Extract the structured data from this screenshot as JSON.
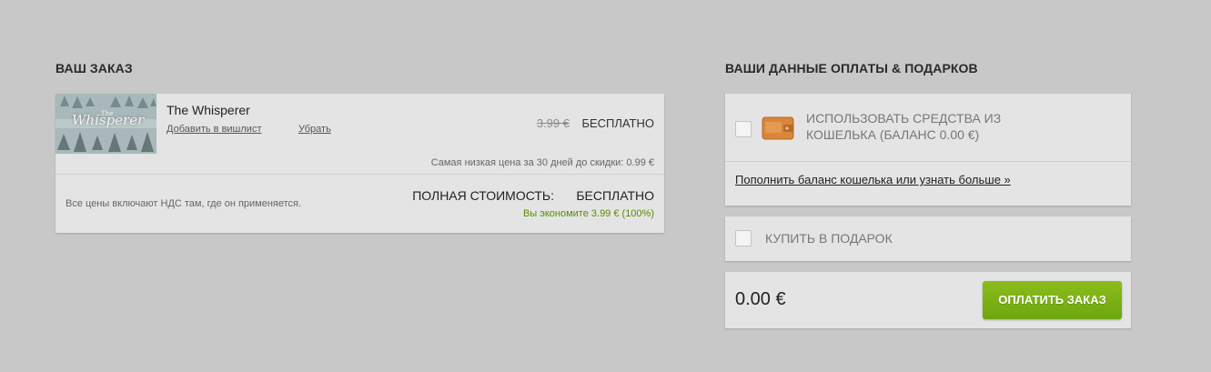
{
  "order": {
    "title": "ВАШ ЗАКАЗ",
    "item": {
      "name": "The Whisperer",
      "thumb_title_small": "The",
      "thumb_title": "Whisperer",
      "wishlist_label": "Добавить в вишлист",
      "remove_label": "Убрать",
      "old_price": "3.99 €",
      "new_price": "БЕСПЛАТНО",
      "lowest_price_note": "Самая низкая цена за 30 дней до скидки: 0.99 €"
    },
    "vat_note": "Все цены включают НДС там, где он применяется.",
    "total_label": "ПОЛНАЯ СТОИМОСТЬ:",
    "total_value": "БЕСПЛАТНО",
    "savings": "Вы экономите 3.99 € (100%)"
  },
  "payment": {
    "title": "ВАШИ ДАННЫЕ ОПЛАТЫ & ПОДАРКОВ",
    "wallet": {
      "label": "ИСПОЛЬЗОВАТЬ СРЕДСТВА ИЗ КОШЕЛЬКА (БАЛАНС 0.00 €)",
      "icon": "wallet-icon",
      "link": "Пополнить баланс кошелька или узнать больше »"
    },
    "gift": {
      "label": "КУПИТЬ В ПОДАРОК"
    },
    "total": "0.00 €",
    "pay_button": "ОПЛАТИТЬ ЗАКАЗ"
  },
  "colors": {
    "background": "#c8c8c8",
    "card": "#e4e4e4",
    "savings_green": "#5c8a00",
    "button_green": "#7fb41a",
    "wallet_orange": "#d9853a"
  }
}
